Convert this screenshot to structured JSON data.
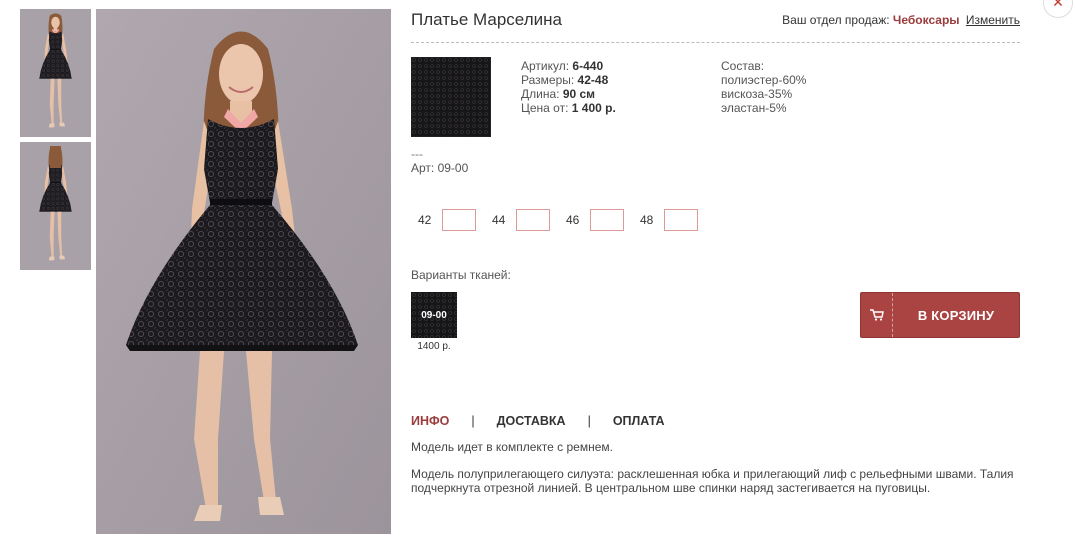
{
  "product": {
    "title": "Платье Марселина",
    "specs": [
      {
        "label": "Артикул:",
        "value": "6-440"
      },
      {
        "label": "Размеры:",
        "value": "42-48"
      },
      {
        "label": "Длина:",
        "value": "90 см"
      },
      {
        "label": "Цена от:",
        "value": "1 400 р."
      }
    ],
    "composition": {
      "title": "Состав:",
      "items": [
        "полиэстер-60%",
        "вискоза-35%",
        "эластан-5%"
      ]
    },
    "dashes": "---",
    "art": "Арт: 09-00"
  },
  "region": {
    "label": "Ваш отдел продаж:",
    "city": "Чебоксары",
    "change_link": "Изменить"
  },
  "sizes": [
    {
      "label": "42",
      "value": ""
    },
    {
      "label": "44",
      "value": ""
    },
    {
      "label": "46",
      "value": ""
    },
    {
      "label": "48",
      "value": ""
    }
  ],
  "variants": {
    "label": "Варианты тканей:",
    "items": [
      {
        "code": "09-00",
        "price": "1400 р."
      }
    ]
  },
  "cart": {
    "label": "В КОРЗИНУ",
    "icon": "cart-icon"
  },
  "tabs": [
    {
      "label": "ИНФО",
      "active": true
    },
    {
      "label": "ДОСТАВКА",
      "active": false
    },
    {
      "label": "ОПЛАТА",
      "active": false
    }
  ],
  "tab_separator": "|",
  "description": {
    "line1": "Модель идет в комплекте с ремнем.",
    "line2": "Модель полуприлегающего силуэта: расклешенная юбка и прилегающий лиф с рельефными швами. Талия подчеркнута отрезной линией. В центральном шве спинки наряд застегивается на пуговицы."
  },
  "colors": {
    "accent": "#a94442",
    "city": "#9b3b3b",
    "photo_background": "#a9a1a8",
    "dress": "#1c1a1f",
    "collar": "#f2a7a7"
  }
}
